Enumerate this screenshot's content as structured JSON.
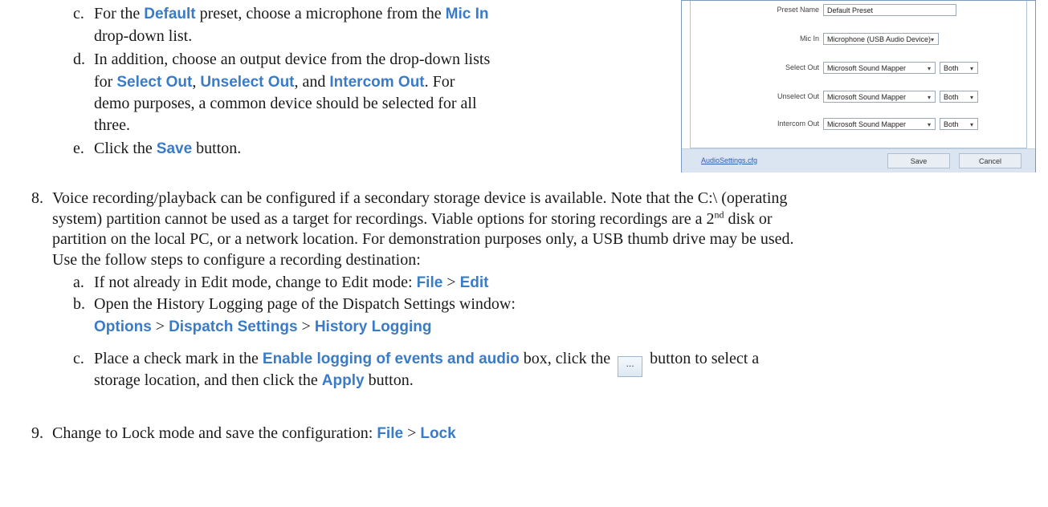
{
  "step7": {
    "c": {
      "label": "c.",
      "pre": "For the ",
      "k1": "Default",
      "mid": " preset, choose a microphone from the ",
      "k2": "Mic In",
      "line2": "drop-down list."
    },
    "d": {
      "label": "d.",
      "line1": "In addition, choose an output device from the drop-down lists",
      "pre": "for ",
      "k1": "Select Out",
      "sep1": ", ",
      "k2": "Unselect Out",
      "sep2": ", and ",
      "k3": "Intercom Out",
      "post": ".  For",
      "line3": "demo purposes, a common device should be selected for all",
      "line4": "three."
    },
    "e": {
      "label": "e.",
      "pre": "Click the ",
      "k": "Save",
      "post": " button."
    }
  },
  "dialog": {
    "preset_name_label": "Preset Name",
    "preset_name_value": "Default Preset",
    "mic_in_label": "Mic In",
    "mic_in_value": "Microphone (USB Audio Device)",
    "select_out_label": "Select Out",
    "select_out_value": "Microsoft Sound Mapper",
    "select_out_channel": "Both",
    "unselect_out_label": "Unselect Out",
    "unselect_out_value": "Microsoft Sound Mapper",
    "unselect_out_channel": "Both",
    "intercom_out_label": "Intercom Out",
    "intercom_out_value": "Microsoft Sound Mapper",
    "intercom_out_channel": "Both",
    "file_link": "AudioSettings.cfg",
    "save": "Save",
    "cancel": "Cancel"
  },
  "step8": {
    "num": "8.",
    "line1a": "Voice recording/playback can be configured if a secondary storage device is available.  Note that the C:\\ (operating",
    "line2a": "system) partition cannot be used as a target for recordings.  Viable options for storing recordings are a 2",
    "sup": "nd",
    "line2b": " disk or",
    "line3": "partition on the local PC, or a network location. For demonstration purposes only, a USB thumb drive may be used.",
    "line4": "Use the follow steps to configure a recording destination:",
    "a": {
      "label": "a.",
      "pre": "If not already in Edit mode, change to Edit mode:  ",
      "k1": "File",
      "sep": " > ",
      "k2": "Edit"
    },
    "b": {
      "label": "b.",
      "line1": "Open the History Logging page of the Dispatch Settings window:",
      "k1": "Options",
      "sep1": " > ",
      "k2": "Dispatch Settings",
      "sep2": " > ",
      "k3": "History Logging"
    },
    "c": {
      "label": "c.",
      "pre": "Place a check mark in the ",
      "k1": "Enable logging of events and audio",
      "mid": " box, click the ",
      "btn": "...",
      "post": " button to select a",
      "line2pre": "storage location, and then click the ",
      "k2": "Apply",
      "line2post": " button."
    }
  },
  "step9": {
    "num": "9.",
    "pre": "Change to Lock mode and save the configuration:  ",
    "k1": "File",
    "sep": " > ",
    "k2": "Lock"
  }
}
